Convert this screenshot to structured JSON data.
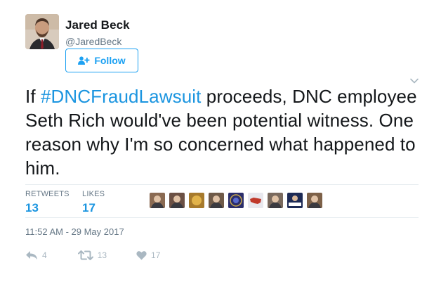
{
  "author": {
    "name": "Jared Beck",
    "handle": "@JaredBeck"
  },
  "follow_button": {
    "label": "Follow",
    "icon": "follow-person-plus-icon"
  },
  "menu_icon": "chevron-down-icon",
  "tweet": {
    "hashtag": "#DNCFraudLawsuit",
    "text_after_hashtag": " proceeds, DNC employee Seth Rich would've been potential witness. One reason why I'm so concerned what happened to him.",
    "text_before_hashtag": "If "
  },
  "stats": {
    "retweets_label": "RETWEETS",
    "retweets_value": "13",
    "likes_label": "LIKES",
    "likes_value": "17"
  },
  "likers": [
    {
      "avatar": "person-photo-icon",
      "color": "#8a6a52"
    },
    {
      "avatar": "person-photo-icon",
      "color": "#6b5044"
    },
    {
      "avatar": "gold-emblem-icon",
      "color": "#a77a2c"
    },
    {
      "avatar": "person-photo-icon",
      "color": "#6f5a48"
    },
    {
      "avatar": "seal-emblem-icon",
      "color": "#2b2e6b"
    },
    {
      "avatar": "us-map-icon",
      "color": "#e8e8ee"
    },
    {
      "avatar": "person-photo-icon",
      "color": "#7a6a5e"
    },
    {
      "avatar": "resistance-badge-icon",
      "color": "#1d2a55"
    },
    {
      "avatar": "person-photo-icon",
      "color": "#7d6148"
    }
  ],
  "timestamp": "11:52 AM - 29 May 2017",
  "actions": {
    "reply_count": "4",
    "retweet_count": "13",
    "like_count": "17"
  },
  "colors": {
    "accent": "#1da1f2",
    "link": "#1b95e0",
    "muted": "#657786",
    "icon_gray": "#aab8c2",
    "divider": "#e6ecf0"
  }
}
